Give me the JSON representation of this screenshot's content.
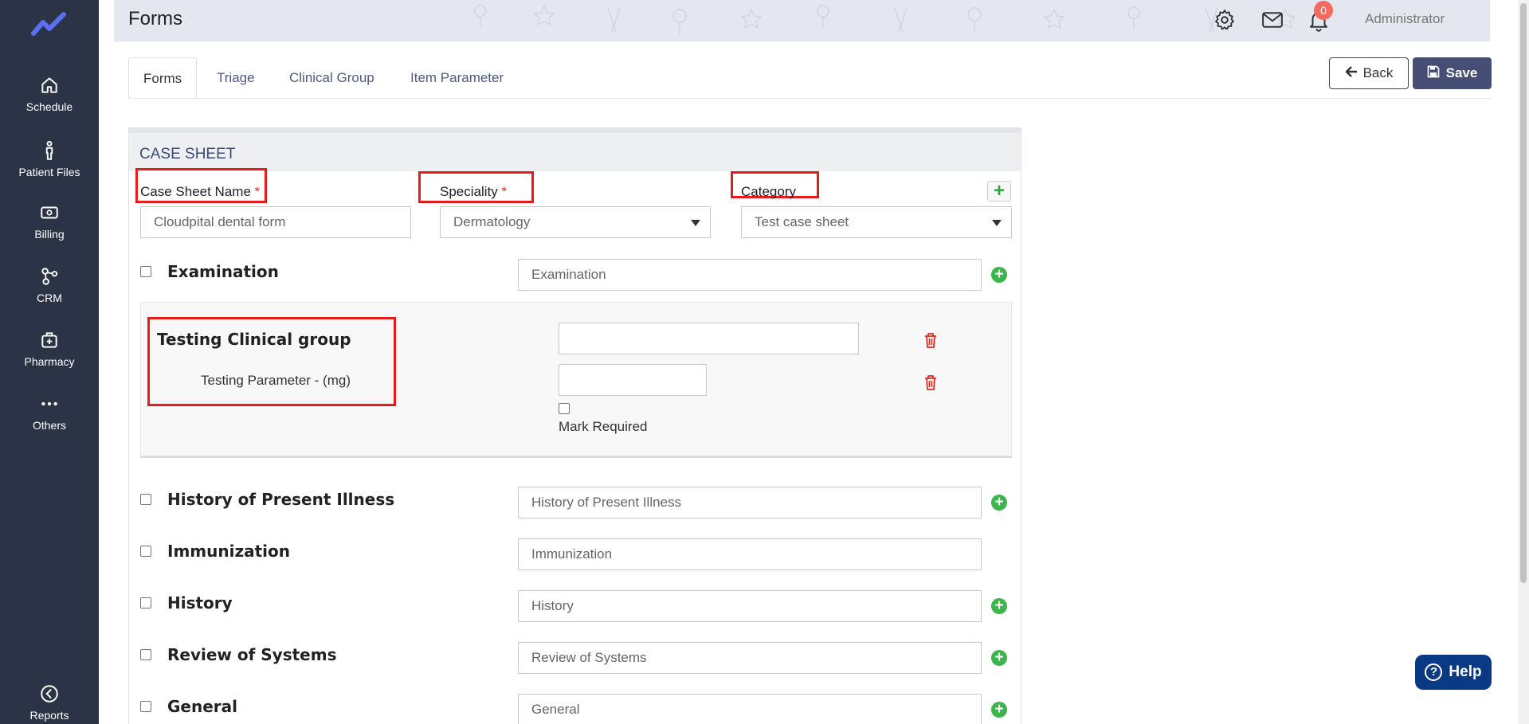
{
  "sidebar": {
    "items": [
      {
        "label": "Schedule",
        "icon": "home-icon"
      },
      {
        "label": "Patient Files",
        "icon": "person-icon"
      },
      {
        "label": "Billing",
        "icon": "cash-icon"
      },
      {
        "label": "CRM",
        "icon": "network-icon"
      },
      {
        "label": "Pharmacy",
        "icon": "medkit-icon"
      },
      {
        "label": "Others",
        "icon": "more-icon"
      },
      {
        "label": "Reports",
        "icon": "chart-circle-icon"
      }
    ]
  },
  "header": {
    "title": "Forms",
    "notification_count": "0",
    "user_name": "Administrator"
  },
  "tabs": [
    {
      "label": "Forms",
      "active": true
    },
    {
      "label": "Triage",
      "active": false
    },
    {
      "label": "Clinical Group",
      "active": false
    },
    {
      "label": "Item Parameter",
      "active": false
    }
  ],
  "actions": {
    "back_label": "Back",
    "save_label": "Save"
  },
  "case_sheet": {
    "heading": "CASE SHEET",
    "name_label": "Case Sheet Name",
    "name_value": "Cloudpital dental form",
    "speciality_label": "Speciality",
    "speciality_value": "Dermatology",
    "category_label": "Category",
    "category_value": "Test case sheet",
    "required_mark": "*"
  },
  "sections": [
    {
      "name": "Examination",
      "value": "Examination",
      "has_add": true
    },
    {
      "name": "History of Present Illness",
      "value": "History of Present Illness",
      "has_add": true
    },
    {
      "name": "Immunization",
      "value": "Immunization",
      "has_add": false
    },
    {
      "name": "History",
      "value": "History",
      "has_add": true
    },
    {
      "name": "Review of Systems",
      "value": "Review of Systems",
      "has_add": true
    },
    {
      "name": "General",
      "value": "General",
      "has_add": true
    }
  ],
  "clinical_group": {
    "title": "Testing Clinical group",
    "parameter_label": "Testing Parameter - (mg)",
    "group_value": "",
    "parameter_value": "",
    "mark_required_label": "Mark Required"
  },
  "help": {
    "label": "Help"
  },
  "colors": {
    "sidebar_bg": "#2b3447",
    "primary": "#464e76",
    "danger": "#e81b1b",
    "success": "#3cb64a",
    "help_bg": "#0b3a84"
  }
}
